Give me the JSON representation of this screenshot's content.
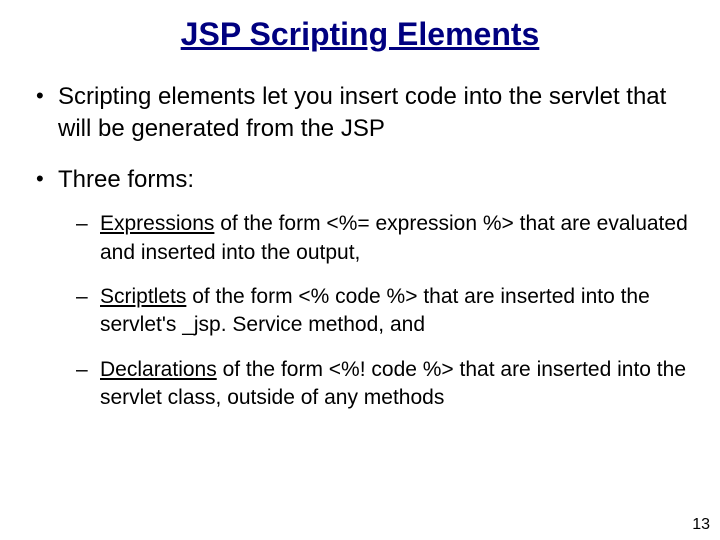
{
  "title": "JSP Scripting Elements",
  "bullets": {
    "b1": "Scripting elements let you insert code into the servlet that will be generated from the JSP",
    "b2": "Three forms:",
    "sub1_term": "Expressions",
    "sub1_rest": " of the form <%= expression %> that are evaluated and inserted into the output,",
    "sub2_term": "Scriptlets",
    "sub2_rest": " of the form <% code %> that are inserted into the servlet's _jsp. Service method, and",
    "sub3_term": "Declarations",
    "sub3_rest": " of the form <%! code %> that are inserted into the servlet class, outside of any methods"
  },
  "page_number": "13"
}
